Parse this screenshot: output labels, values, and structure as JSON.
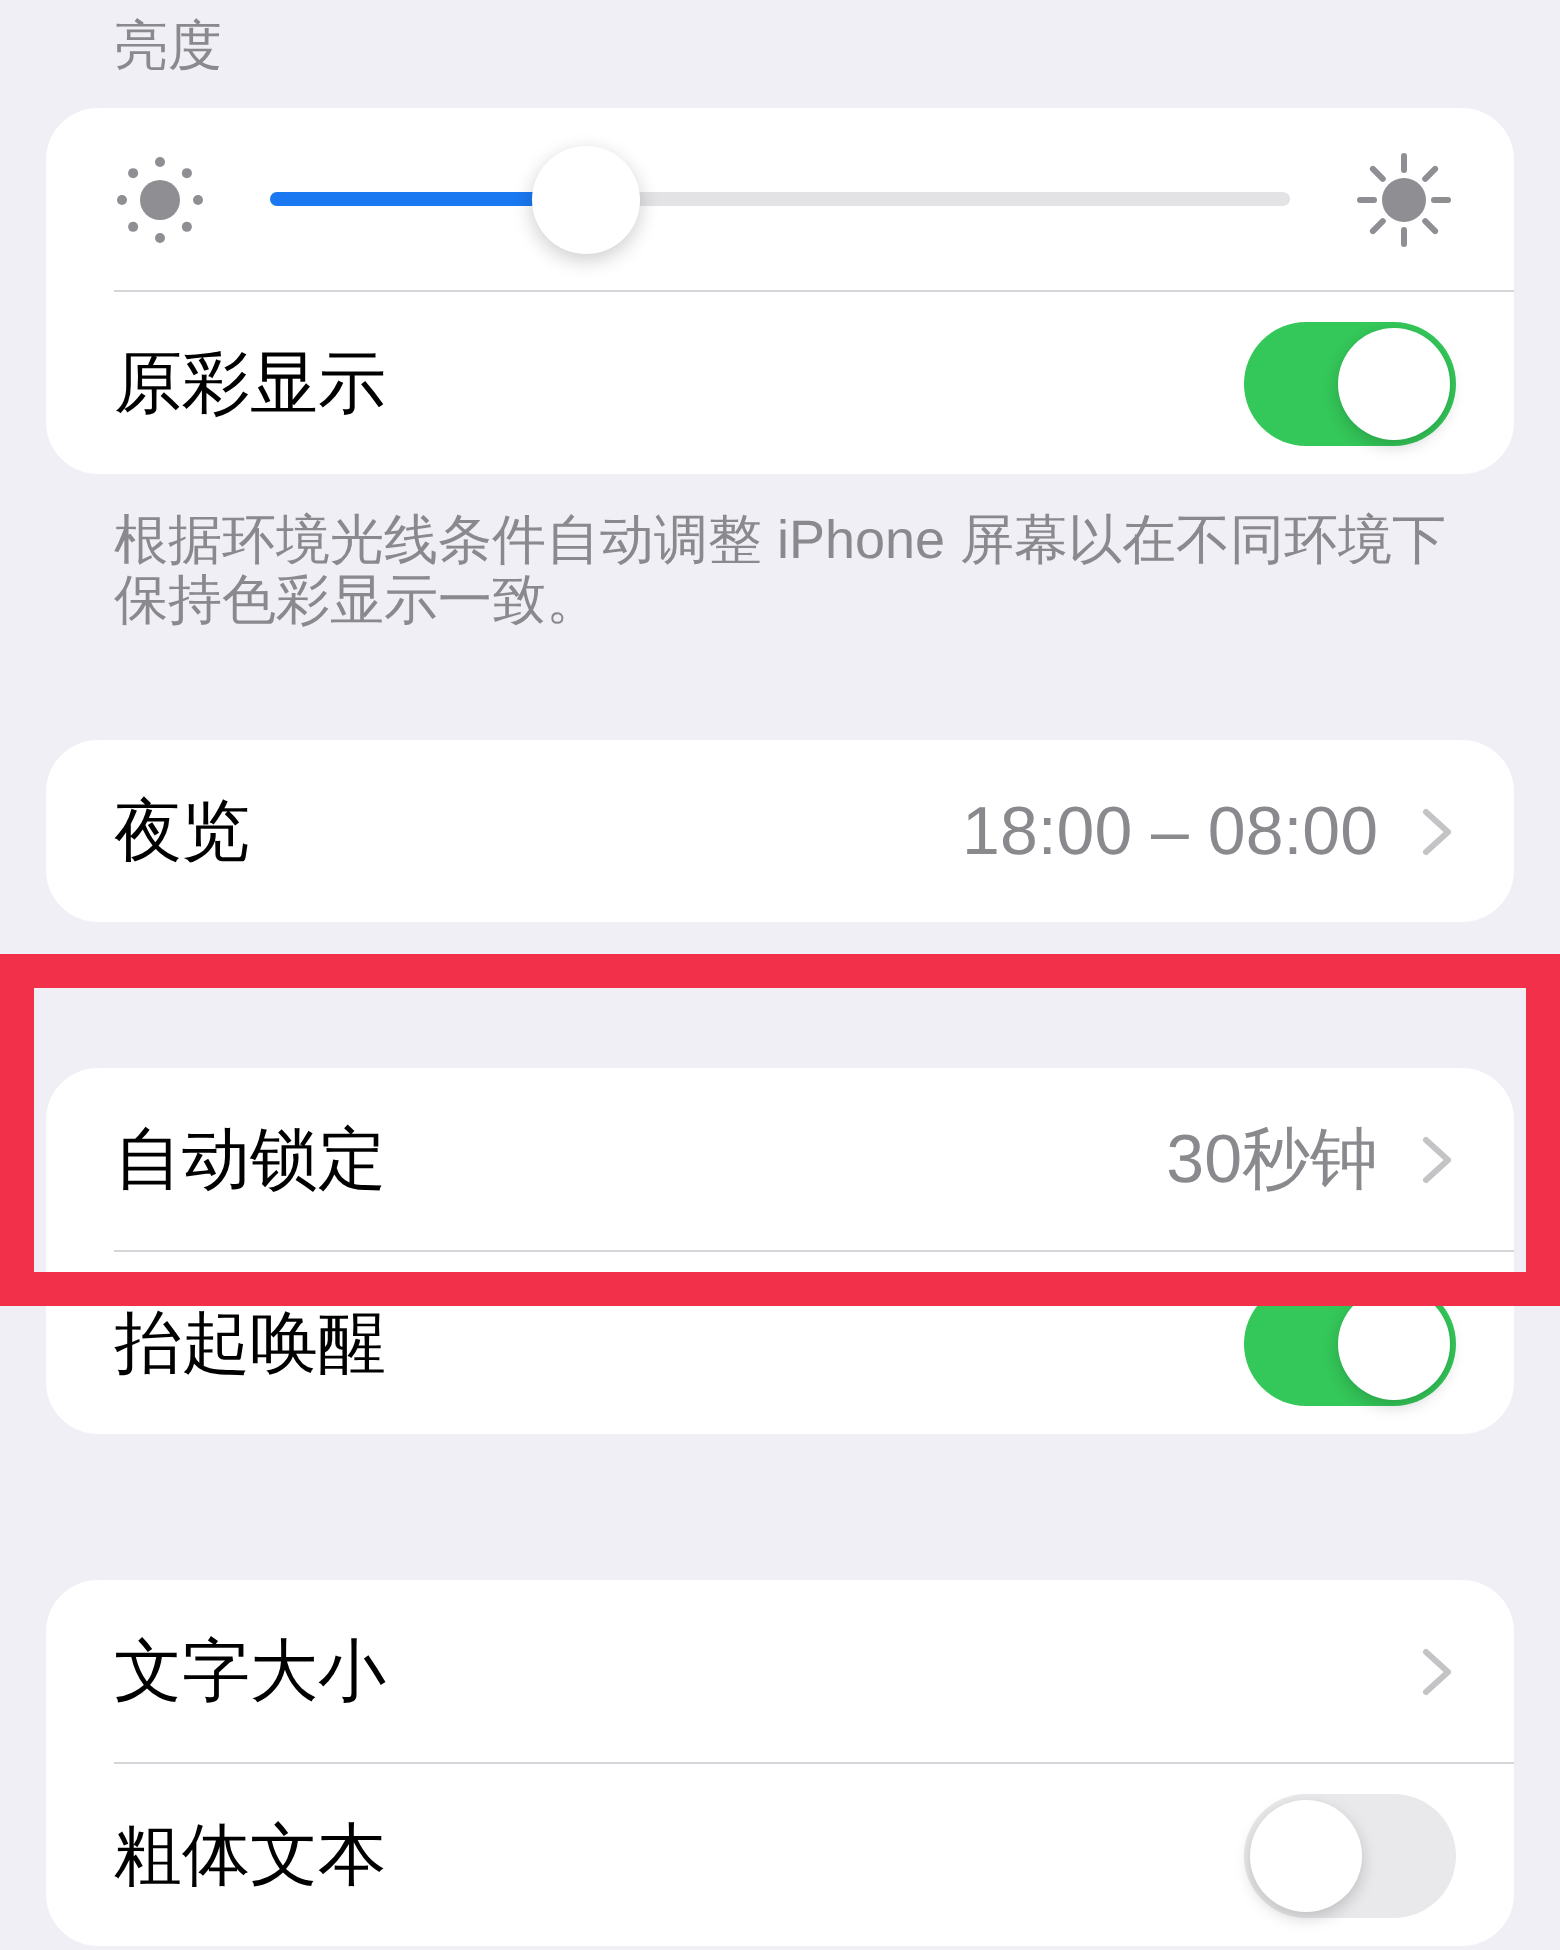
{
  "groups": [
    {
      "header": "亮度",
      "rows": [
        {
          "kind": "slider",
          "level": 0.31
        },
        {
          "kind": "toggle",
          "label": "原彩显示",
          "on": true
        }
      ],
      "footer": "根据环境光线条件自动调整 iPhone 屏幕以在不同环境下保持色彩显示一致。"
    },
    {
      "rows": [
        {
          "kind": "link",
          "label": "夜览",
          "value": "18:00 – 08:00"
        }
      ]
    },
    {
      "rows": [
        {
          "kind": "link",
          "label": "自动锁定",
          "value": "30秒钟"
        },
        {
          "kind": "toggle",
          "label": "抬起唤醒",
          "on": true
        }
      ]
    },
    {
      "rows": [
        {
          "kind": "link",
          "label": "文字大小"
        },
        {
          "kind": "toggle",
          "label": "粗体文本",
          "on": false
        }
      ]
    }
  ]
}
